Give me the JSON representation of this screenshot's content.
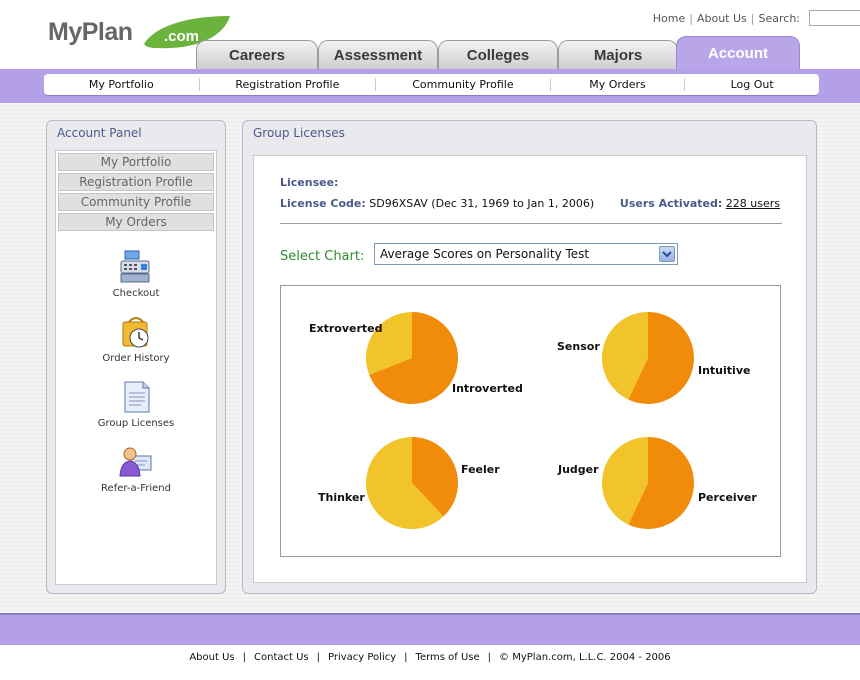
{
  "header": {
    "logo_text": "MyPlan",
    "logo_suffix": ".com",
    "links": [
      "Home",
      "About Us",
      "Search:"
    ],
    "search_value": ""
  },
  "tabs": [
    {
      "label": "Careers",
      "active": false
    },
    {
      "label": "Assessment",
      "active": false
    },
    {
      "label": "Colleges",
      "active": false
    },
    {
      "label": "Majors",
      "active": false
    },
    {
      "label": "Account",
      "active": true
    }
  ],
  "subnav": [
    "My Portfolio",
    "Registration Profile",
    "Community Profile",
    "My Orders",
    "Log Out"
  ],
  "account_panel": {
    "title": "Account Panel",
    "menu": [
      "My Portfolio",
      "Registration Profile",
      "Community Profile",
      "My Orders"
    ],
    "icons": [
      {
        "label": "Checkout",
        "icon": "cash-register-icon"
      },
      {
        "label": "Order History",
        "icon": "clock-bag-icon"
      },
      {
        "label": "Group Licenses",
        "icon": "document-icon"
      },
      {
        "label": "Refer-a-Friend",
        "icon": "person-card-icon"
      }
    ]
  },
  "group_licenses": {
    "title": "Group Licenses",
    "licensee_label": "Licensee:",
    "licensee_value": "",
    "license_code_label": "License Code:",
    "license_code_value": "SD96XSAV (Dec 31, 1969 to Jan 1, 2006)",
    "users_label": "Users Activated:",
    "users_value": "228 users",
    "select_label": "Select Chart:",
    "select_value": "Average Scores on Personality Test"
  },
  "chart_data": {
    "type": "pie",
    "charts": [
      {
        "slices": [
          {
            "label": "Extroverted",
            "value": 31,
            "color": "#f0c42a"
          },
          {
            "label": "Introverted",
            "value": 69,
            "color": "#f08c0a"
          }
        ]
      },
      {
        "slices": [
          {
            "label": "Sensor",
            "value": 43,
            "color": "#f0c42a"
          },
          {
            "label": "Intuitive",
            "value": 57,
            "color": "#f08c0a"
          }
        ]
      },
      {
        "slices": [
          {
            "label": "Feeler",
            "value": 38,
            "color": "#f08c0a"
          },
          {
            "label": "Thinker",
            "value": 62,
            "color": "#f0c42a"
          }
        ]
      },
      {
        "slices": [
          {
            "label": "Judger",
            "value": 43,
            "color": "#f0c42a"
          },
          {
            "label": "Perceiver",
            "value": 57,
            "color": "#f08c0a"
          }
        ]
      }
    ]
  },
  "footer": [
    "About Us",
    "Contact Us",
    "Privacy Policy",
    "Terms of Use",
    "© MyPlan.com, L.L.C. 2004 - 2006"
  ],
  "colors": {
    "purple": "#b3a0e6",
    "orange": "#f08c0a",
    "yellow": "#f0c42a",
    "green": "#2f8a2f"
  }
}
